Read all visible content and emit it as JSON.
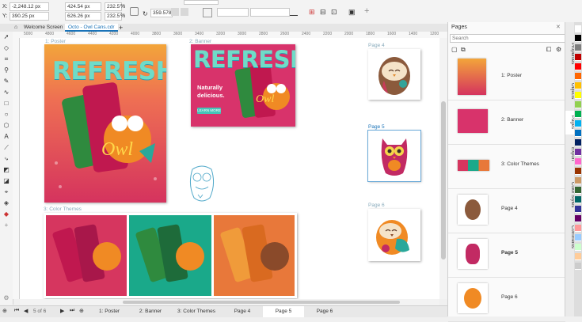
{
  "propbar": {
    "x_label": "X:",
    "x_value": "-2,248.12 px",
    "y_label": "Y:",
    "y_value": "390.25 px",
    "w_value": "424.54 px",
    "h_value": "626.26 px",
    "sx_value": "232.5",
    "sy_value": "232.5",
    "unit_pct": "%",
    "rotation_value": "359.578"
  },
  "tabs": {
    "welcome": "Welcome Screen",
    "doc": "Octo - Owl Cans.cdr",
    "add": "+"
  },
  "ruler": [
    "5000",
    "4800",
    "4600",
    "4400",
    "4200",
    "4000",
    "3800",
    "3600",
    "3400",
    "3200",
    "3000",
    "2800",
    "2600",
    "2400",
    "2200",
    "2000",
    "1800",
    "1600",
    "1400",
    "1200"
  ],
  "canvas": {
    "poster_label": "1: Poster",
    "banner_label": "2: Banner",
    "colorthemes_label": "3: Color Themes",
    "page4_label": "Page 4",
    "page5_label": "Page 5",
    "page6_label": "Page 6",
    "refresh_text": "REFRESH",
    "owl_text": "Owl",
    "banner_tagline": "Naturally delicious.",
    "banner_button": "LEARN MORE"
  },
  "pagebar": {
    "page_counter": "5 of 6",
    "tabs": [
      "1: Poster",
      "2: Banner",
      "3: Color Themes",
      "Page 4",
      "Page 5",
      "Page 6"
    ],
    "active": "Page 5"
  },
  "docker": {
    "title": "Pages",
    "search_placeholder": "Search",
    "items": [
      "1: Poster",
      "2: Banner",
      "3: Color Themes",
      "Page 4",
      "Page 5",
      "Page 6"
    ],
    "active": "Page 5"
  },
  "sidetabs": [
    "Properties",
    "Objects",
    "Pages",
    "Export",
    "Color Styles",
    "Comments"
  ],
  "colors": {
    "accent": "#1a73b8",
    "palette": [
      "#ffffff",
      "#000000",
      "#7f7f7f",
      "#c00000",
      "#ff0000",
      "#ff6600",
      "#ffc000",
      "#ffff00",
      "#92d050",
      "#00b050",
      "#00b0f0",
      "#0070c0",
      "#002060",
      "#7030a0",
      "#ff66cc",
      "#993300",
      "#cc9966",
      "#336633",
      "#006666",
      "#333399",
      "#660066",
      "#ff9999",
      "#99ccff",
      "#ccffcc",
      "#ffcc99",
      "#cccccc"
    ]
  }
}
